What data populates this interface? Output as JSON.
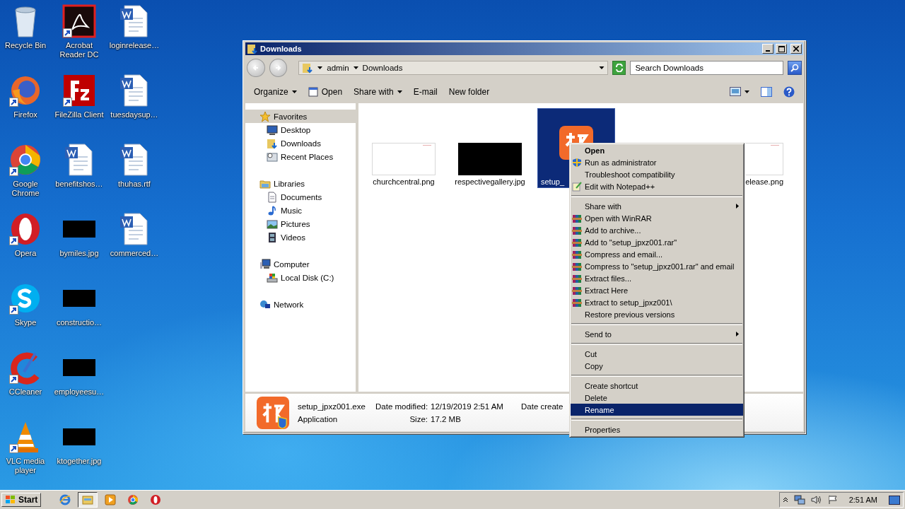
{
  "desktop": {
    "icons": [
      {
        "label": "Recycle Bin",
        "kind": "recycle",
        "shortcut": false
      },
      {
        "label": "Firefox",
        "kind": "firefox",
        "shortcut": true
      },
      {
        "label": "Google Chrome",
        "kind": "chrome",
        "shortcut": true
      },
      {
        "label": "Opera",
        "kind": "opera",
        "shortcut": true
      },
      {
        "label": "Skype",
        "kind": "skype",
        "shortcut": true
      },
      {
        "label": "CCleaner",
        "kind": "ccleaner",
        "shortcut": true
      },
      {
        "label": "VLC media player",
        "kind": "vlc",
        "shortcut": true
      },
      {
        "label": "Acrobat Reader DC",
        "kind": "acrobat",
        "shortcut": true
      },
      {
        "label": "FileZilla Client",
        "kind": "filezilla",
        "shortcut": true
      },
      {
        "label": "benefitshos…",
        "kind": "document",
        "shortcut": false
      },
      {
        "label": "bymiles.jpg",
        "kind": "image",
        "shortcut": false
      },
      {
        "label": "constructio…",
        "kind": "image",
        "shortcut": false
      },
      {
        "label": "employeesu…",
        "kind": "image",
        "shortcut": false
      },
      {
        "label": "ktogether.jpg",
        "kind": "image",
        "shortcut": false
      },
      {
        "label": "loginrelease…",
        "kind": "document",
        "shortcut": false
      },
      {
        "label": "tuesdaysup…",
        "kind": "document",
        "shortcut": false
      },
      {
        "label": "thuhas.rtf",
        "kind": "document",
        "shortcut": false
      },
      {
        "label": "commerced…",
        "kind": "document",
        "shortcut": false
      }
    ]
  },
  "window": {
    "title": "Downloads",
    "address": {
      "crumbs": [
        "admin",
        "Downloads"
      ]
    },
    "search": {
      "placeholder": "Search Downloads"
    },
    "toolbar": [
      {
        "label": "Organize",
        "kind": "menu"
      },
      {
        "label": "Open",
        "kind": "open"
      },
      {
        "label": "Share with",
        "kind": "menu"
      },
      {
        "label": "E-mail",
        "kind": "plain"
      },
      {
        "label": "New folder",
        "kind": "plain"
      }
    ],
    "nav": [
      {
        "label": "Favorites",
        "kind": "favorites",
        "selected": true,
        "children": [
          {
            "label": "Desktop",
            "kind": "desktop",
            "selected": false
          },
          {
            "label": "Downloads",
            "kind": "downloads",
            "selected": false
          },
          {
            "label": "Recent Places",
            "kind": "recent",
            "selected": false
          }
        ]
      },
      {
        "label": "Libraries",
        "kind": "libraries",
        "selected": false,
        "children": [
          {
            "label": "Documents",
            "kind": "documents",
            "selected": false
          },
          {
            "label": "Music",
            "kind": "music",
            "selected": false
          },
          {
            "label": "Pictures",
            "kind": "pictures",
            "selected": false
          },
          {
            "label": "Videos",
            "kind": "videos",
            "selected": false
          }
        ]
      },
      {
        "label": "Computer",
        "kind": "computer",
        "selected": false,
        "children": [
          {
            "label": "Local Disk (C:)",
            "kind": "disk",
            "selected": false
          }
        ]
      },
      {
        "label": "Network",
        "kind": "network",
        "selected": false
      }
    ],
    "files": [
      {
        "label": "churchcentral.png",
        "kind": "light_image",
        "selected": false
      },
      {
        "label": "respectivegallery.jpg",
        "kind": "dark_image",
        "selected": false
      },
      {
        "label": "setup_",
        "kind": "app",
        "selected": true
      },
      {
        "label": "elease.png",
        "kind": "light_image",
        "selected": false
      }
    ],
    "details": {
      "name": "setup_jpxz001.exe",
      "type": "Application",
      "fields": [
        {
          "label": "Date modified:",
          "value": "12/19/2019 2:51 AM"
        },
        {
          "label": "Size:",
          "value": "17.2 MB"
        }
      ],
      "extra_label": "Date create"
    }
  },
  "context_menu": {
    "groups": [
      [
        {
          "label": "Open",
          "kind": "plain",
          "default": true,
          "submenu": false,
          "selected": false
        },
        {
          "label": "Run as administrator",
          "kind": "elevated",
          "default": false,
          "submenu": false,
          "selected": false
        },
        {
          "label": "Troubleshoot compatibility",
          "kind": "plain",
          "default": false,
          "submenu": false,
          "selected": false
        },
        {
          "label": "Edit with Notepad++",
          "kind": "editor",
          "default": false,
          "submenu": false,
          "selected": false
        }
      ],
      [
        {
          "label": "Share with",
          "kind": "plain",
          "default": false,
          "submenu": true,
          "selected": false
        },
        {
          "label": "Open with WinRAR",
          "kind": "archive",
          "default": false,
          "submenu": false,
          "selected": false
        },
        {
          "label": "Add to archive...",
          "kind": "archive",
          "default": false,
          "submenu": false,
          "selected": false
        },
        {
          "label": "Add to \"setup_jpxz001.rar\"",
          "kind": "archive",
          "default": false,
          "submenu": false,
          "selected": false
        },
        {
          "label": "Compress and email...",
          "kind": "archive",
          "default": false,
          "submenu": false,
          "selected": false
        },
        {
          "label": "Compress to \"setup_jpxz001.rar\" and email",
          "kind": "archive",
          "default": false,
          "submenu": false,
          "selected": false
        },
        {
          "label": "Extract files...",
          "kind": "archive",
          "default": false,
          "submenu": false,
          "selected": false
        },
        {
          "label": "Extract Here",
          "kind": "archive",
          "default": false,
          "submenu": false,
          "selected": false
        },
        {
          "label": "Extract to setup_jpxz001\\",
          "kind": "archive",
          "default": false,
          "submenu": false,
          "selected": false
        },
        {
          "label": "Restore previous versions",
          "kind": "plain",
          "default": false,
          "submenu": false,
          "selected": false
        }
      ],
      [
        {
          "label": "Send to",
          "default": false,
          "submenu": true,
          "selected": false
        }
      ],
      [
        {
          "label": "Cut",
          "default": false,
          "submenu": false,
          "selected": false
        },
        {
          "label": "Copy",
          "default": false,
          "submenu": false,
          "selected": false
        }
      ],
      [
        {
          "label": "Create shortcut",
          "default": false,
          "submenu": false,
          "selected": false
        },
        {
          "label": "Delete",
          "default": false,
          "submenu": false,
          "selected": false
        },
        {
          "label": "Rename",
          "default": false,
          "submenu": false,
          "selected": true
        }
      ],
      [
        {
          "label": "Properties",
          "default": false,
          "submenu": false,
          "selected": false
        }
      ]
    ]
  },
  "taskbar": {
    "start": "Start",
    "apps": [
      {
        "kind": "ie",
        "selected": false
      },
      {
        "kind": "explorer",
        "selected": true
      },
      {
        "kind": "media",
        "selected": false
      },
      {
        "kind": "chrome",
        "selected": false
      },
      {
        "kind": "opera",
        "selected": false
      }
    ],
    "clock": "2:51 AM"
  }
}
